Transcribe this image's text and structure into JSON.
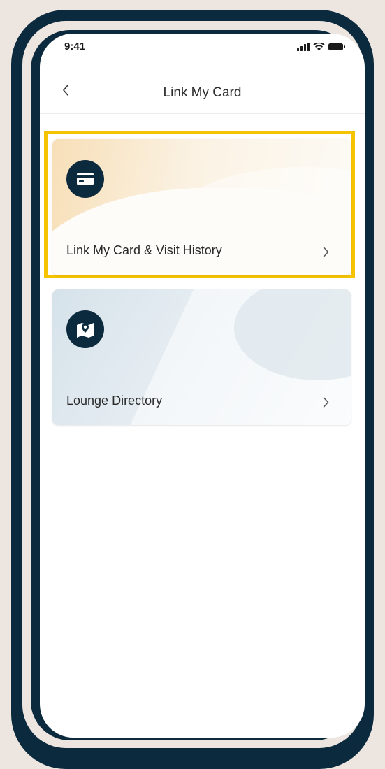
{
  "status_bar": {
    "time": "9:41"
  },
  "nav": {
    "title": "Link My Card",
    "back_icon": "chevron-left-icon"
  },
  "cards": [
    {
      "label": "Link My Card & Visit History",
      "icon": "credit-card-icon",
      "highlighted": true
    },
    {
      "label": "Lounge Directory",
      "icon": "map-pin-icon",
      "highlighted": false
    }
  ],
  "colors": {
    "frame": "#0c2a3e",
    "highlight": "#f5c300",
    "background": "#ede6e0"
  }
}
